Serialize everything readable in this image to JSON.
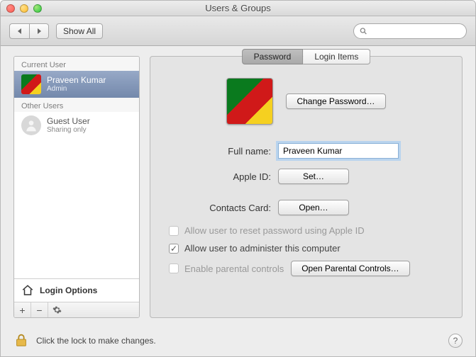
{
  "window": {
    "title": "Users & Groups"
  },
  "toolbar": {
    "showAll": "Show All",
    "searchPlaceholder": ""
  },
  "sidebar": {
    "currentHeader": "Current User",
    "otherHeader": "Other Users",
    "current": {
      "name": "Praveen Kumar",
      "role": "Admin"
    },
    "guest": {
      "name": "Guest User",
      "role": "Sharing only"
    },
    "loginOptions": "Login Options"
  },
  "tabs": {
    "password": "Password",
    "loginItems": "Login Items"
  },
  "main": {
    "changePassword": "Change Password…",
    "fullNameLabel": "Full name:",
    "fullNameValue": "Praveen Kumar",
    "appleIdLabel": "Apple ID:",
    "setBtn": "Set…",
    "contactsLabel": "Contacts Card:",
    "openBtn": "Open…",
    "allowReset": "Allow user to reset password using Apple ID",
    "allowAdmin": "Allow user to administer this computer",
    "enablePC": "Enable parental controls",
    "openPC": "Open Parental Controls…"
  },
  "footer": {
    "lockText": "Click the lock to make changes.",
    "help": "?"
  }
}
